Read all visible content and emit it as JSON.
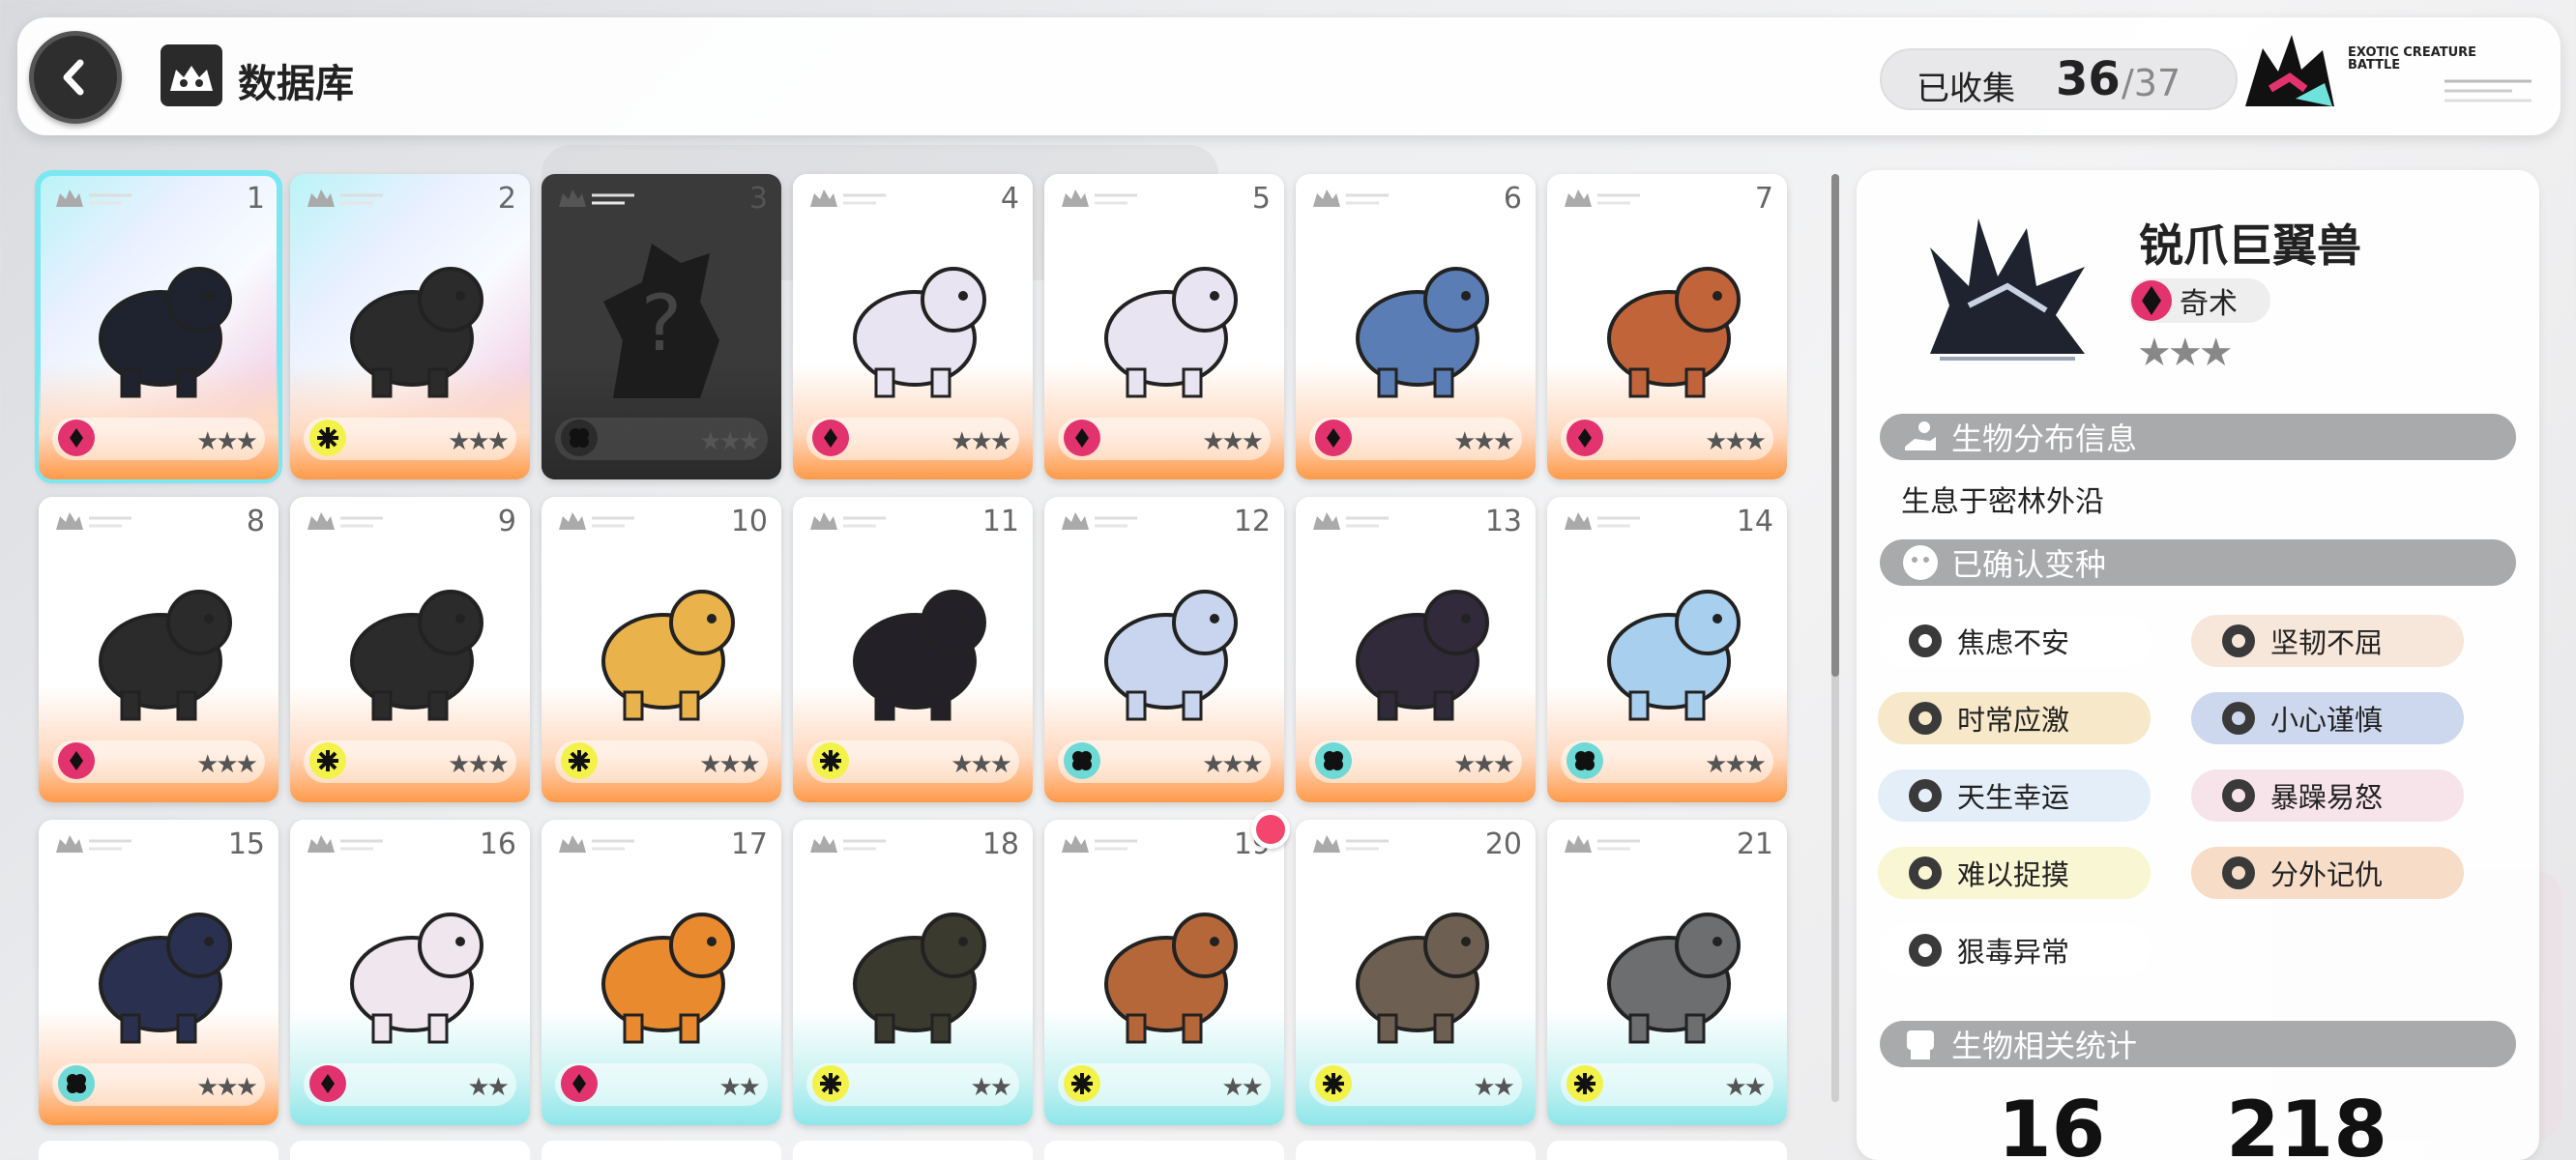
{
  "header": {
    "title": "数据库",
    "collected_label": "已收集",
    "collected_count": "36",
    "collected_total": "/37",
    "brand_text": "EXOTIC CREATURE BATTLE"
  },
  "cards": [
    {
      "num": "1",
      "element": "arcane",
      "rarity": "★★★",
      "selected": true,
      "locked": false
    },
    {
      "num": "2",
      "element": "nature",
      "rarity": "★★★",
      "selected": false,
      "locked": false
    },
    {
      "num": "3",
      "element": "water",
      "rarity": "★★★",
      "selected": false,
      "locked": true
    },
    {
      "num": "4",
      "element": "arcane",
      "rarity": "★★★",
      "selected": false,
      "locked": false
    },
    {
      "num": "5",
      "element": "arcane",
      "rarity": "★★★",
      "selected": false,
      "locked": false
    },
    {
      "num": "6",
      "element": "arcane",
      "rarity": "★★★",
      "selected": false,
      "locked": false
    },
    {
      "num": "7",
      "element": "arcane",
      "rarity": "★★★",
      "selected": false,
      "locked": false
    },
    {
      "num": "8",
      "element": "arcane",
      "rarity": "★★★",
      "selected": false,
      "locked": false
    },
    {
      "num": "9",
      "element": "nature",
      "rarity": "★★★",
      "selected": false,
      "locked": false
    },
    {
      "num": "10",
      "element": "nature",
      "rarity": "★★★",
      "selected": false,
      "locked": false
    },
    {
      "num": "11",
      "element": "nature",
      "rarity": "★★★",
      "selected": false,
      "locked": false
    },
    {
      "num": "12",
      "element": "water",
      "rarity": "★★★",
      "selected": false,
      "locked": false
    },
    {
      "num": "13",
      "element": "water",
      "rarity": "★★★",
      "selected": false,
      "locked": false
    },
    {
      "num": "14",
      "element": "water",
      "rarity": "★★★",
      "selected": false,
      "locked": false
    },
    {
      "num": "15",
      "element": "water",
      "rarity": "★★★",
      "selected": false,
      "locked": false
    },
    {
      "num": "16",
      "element": "arcane",
      "rarity": "★★",
      "selected": false,
      "locked": false
    },
    {
      "num": "17",
      "element": "arcane",
      "rarity": "★★",
      "selected": false,
      "locked": false
    },
    {
      "num": "18",
      "element": "nature",
      "rarity": "★★",
      "selected": false,
      "locked": false
    },
    {
      "num": "19",
      "element": "nature",
      "rarity": "★★",
      "selected": false,
      "locked": false,
      "new": true
    },
    {
      "num": "20",
      "element": "nature",
      "rarity": "★★",
      "selected": false,
      "locked": false
    },
    {
      "num": "21",
      "element": "nature",
      "rarity": "★★",
      "selected": false,
      "locked": false
    }
  ],
  "detail": {
    "name": "锐爪巨翼兽",
    "type": "奇术",
    "stars": "★★★",
    "distribution_title": "生物分布信息",
    "distribution_text": "生息于密林外沿",
    "variants_title": "已确认变种",
    "traits": [
      {
        "label": "焦虑不安",
        "bg": "#ffffff",
        "icon": "worried-face-icon"
      },
      {
        "label": "坚韧不屈",
        "bg": "#f7e6da",
        "icon": "v-shape-icon"
      },
      {
        "label": "时常应激",
        "bg": "#f6e8c8",
        "icon": "zigzag-icon"
      },
      {
        "label": "小心谨慎",
        "bg": "#cdd8ef",
        "icon": "gear-burst-icon"
      },
      {
        "label": "天生幸运",
        "bg": "#e4eef8",
        "icon": "clover-icon"
      },
      {
        "label": "暴躁易怒",
        "bg": "#f7e4ea",
        "icon": "flame-icon"
      },
      {
        "label": "难以捉摸",
        "bg": "#f9f6d4",
        "icon": "spiral-icon"
      },
      {
        "label": "分外记仇",
        "bg": "#f7dcc8",
        "icon": "sun-icon"
      },
      {
        "label": "狠毒异常",
        "bg": "#ffffff",
        "icon": "diamond-icon"
      }
    ],
    "stats_title": "生物相关统计",
    "stat_a": "16",
    "stat_b": "218"
  },
  "colors": {
    "arcane": "#e2336f",
    "nature": "#f3f24a",
    "water": "#6fd9d6",
    "selected_outline": "#7be7f3"
  }
}
